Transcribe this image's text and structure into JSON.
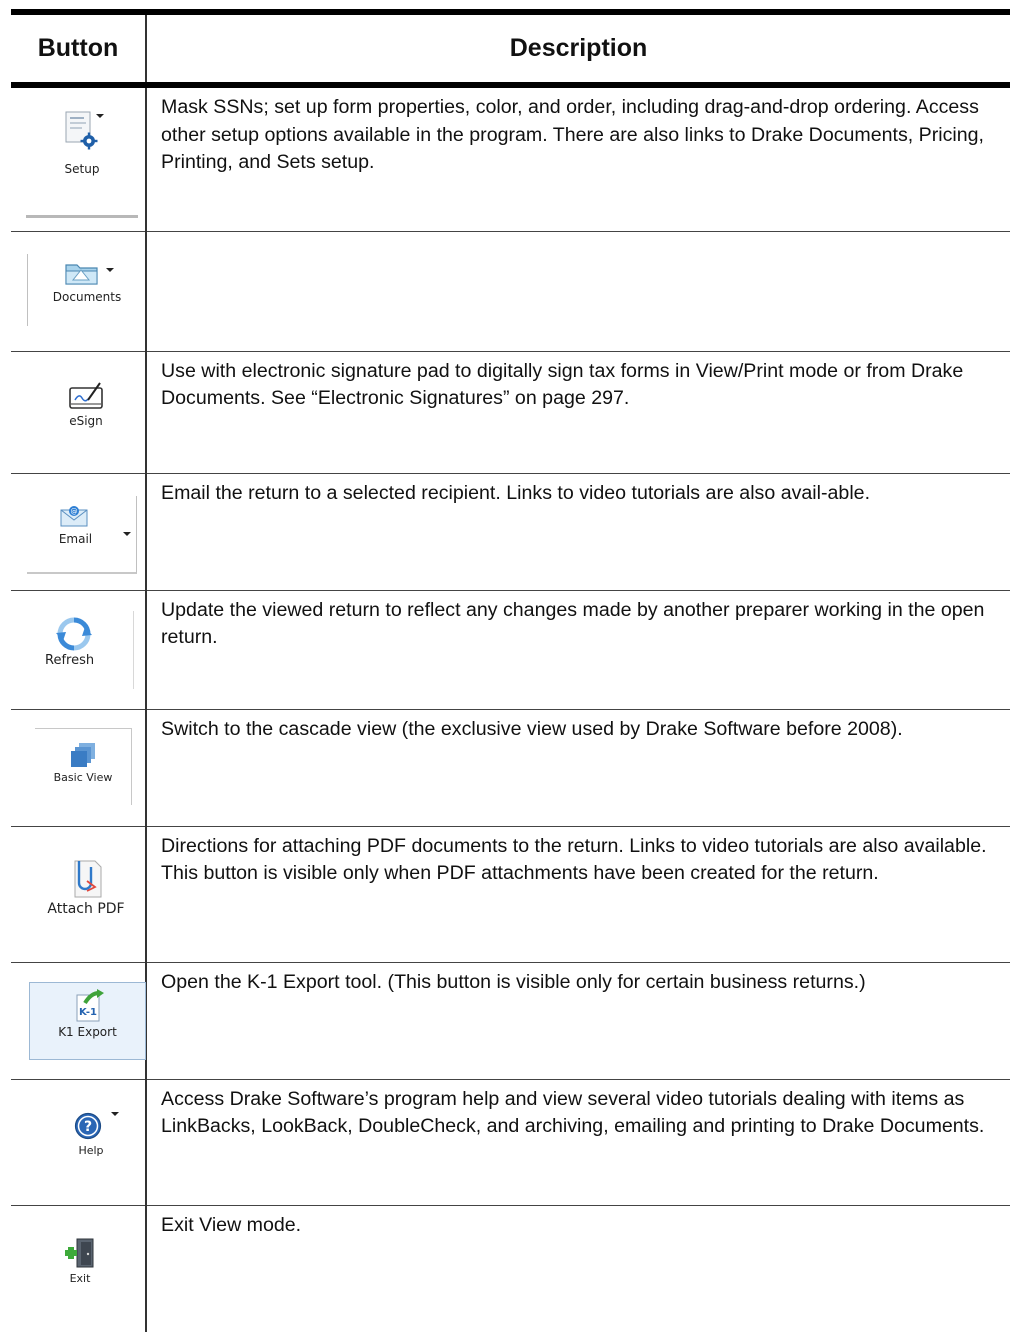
{
  "headers": {
    "button": "Button",
    "description": "Description"
  },
  "rows": [
    {
      "button_label": "Setup",
      "icon": "setup-icon",
      "has_dropdown": true,
      "description": "Mask SSNs; set up form properties, color, and order, including drag-and-drop ordering. Access other setup options available in the program. There are also links to Drake Documents, Pricing, Printing, and Sets setup."
    },
    {
      "button_label": "Documents",
      "icon": "folder-icon",
      "has_dropdown": true,
      "description": ""
    },
    {
      "button_label": "eSign",
      "icon": "signature-pad-icon",
      "has_dropdown": false,
      "description": "Use with electronic signature pad to digitally sign tax forms in View/Print mode or from Drake Documents. See “Electronic Signatures” on page 297."
    },
    {
      "button_label": "Email",
      "icon": "email-envelope-icon",
      "has_dropdown": true,
      "description": "Email the return to a selected recipient. Links to video tutorials are also avail-able."
    },
    {
      "button_label": "Refresh",
      "icon": "refresh-icon",
      "has_dropdown": false,
      "description": "Update the viewed return to reflect any changes made by another preparer working in the open return."
    },
    {
      "button_label": "Basic View",
      "icon": "cascade-windows-icon",
      "has_dropdown": false,
      "description": "Switch to the cascade view (the exclusive view used by Drake Software before 2008)."
    },
    {
      "button_label": "Attach PDF",
      "icon": "paperclip-pdf-icon",
      "has_dropdown": false,
      "description": "Directions for attaching PDF documents to the return. Links to video tutorials are also available. This button is visible only when PDF attachments have been created for the return."
    },
    {
      "button_label": "K1 Export",
      "icon": "k1-export-icon",
      "has_dropdown": false,
      "description": "Open the K-1 Export tool. (This button is visible only for certain business returns.)"
    },
    {
      "button_label": "Help",
      "icon": "help-icon",
      "has_dropdown": true,
      "description": "Access Drake Software’s program help and view several video tutorials dealing with items as LinkBacks, LookBack, DoubleCheck, and archiving, emailing and printing to Drake Documents."
    },
    {
      "button_label": "Exit",
      "icon": "exit-door-icon",
      "has_dropdown": false,
      "description": "Exit View mode."
    }
  ]
}
